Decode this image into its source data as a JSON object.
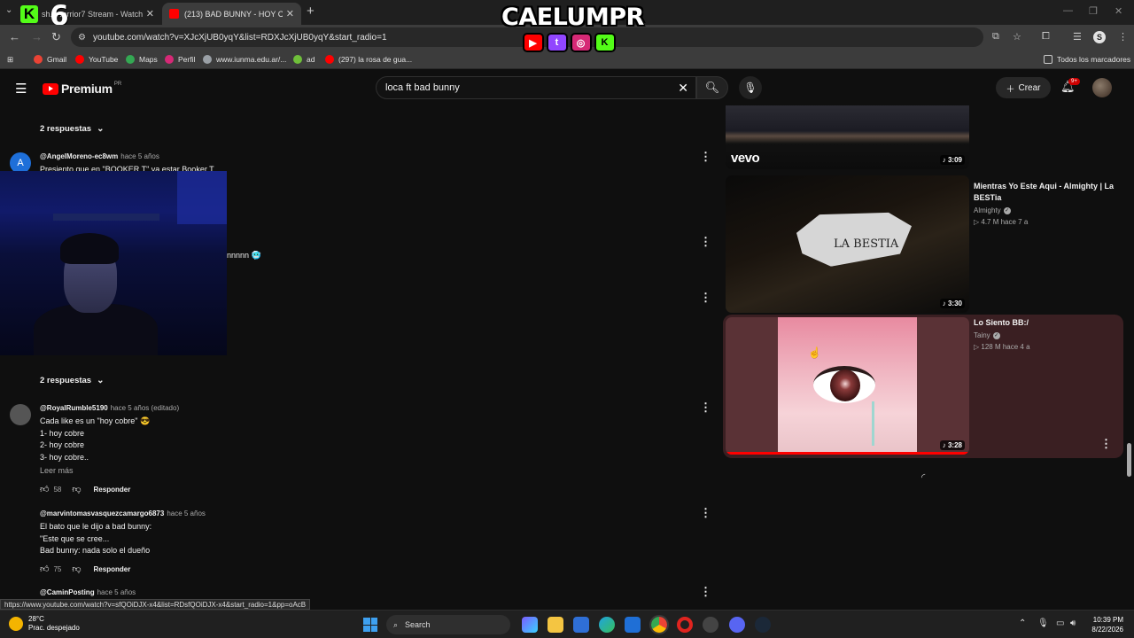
{
  "browser": {
    "tabs": [
      {
        "label": "sh...warrior7 Stream - Watch",
        "fav_color": "#53fc18"
      },
      {
        "label": "(213) BAD BUNNY - HOY COBRE",
        "fav_color": "#ff0000"
      }
    ],
    "url": "youtube.com/watch?v=XJcXjUB0yqY&list=RDXJcXjUB0yqY&start_radio=1",
    "bookmarks": [
      "Gmail",
      "YouTube",
      "Maps",
      "Perfil",
      "www.iunma.edu.ar/...",
      "ad",
      "(297) la rosa de gua..."
    ],
    "all_bookmarks": "Todos los marcadores",
    "status_url": "https://www.youtube.com/watch?v=sfQOiDJX-x4&list=RDsfQOiDJX-x4&start_radio=1&pp=oAcB"
  },
  "overlay": {
    "brand": "CAELUMPR",
    "number": "6",
    "k": "K",
    "socials": [
      {
        "icon": "youtube-icon",
        "glyph": "▶",
        "color": "#ff0000"
      },
      {
        "icon": "twitch-icon",
        "glyph": "t",
        "color": "#9146ff"
      },
      {
        "icon": "instagram-icon",
        "glyph": "◎",
        "color": "#d62976"
      },
      {
        "icon": "kick-icon",
        "glyph": "K",
        "color": "#53fc18"
      }
    ]
  },
  "youtube": {
    "logo_word": "Premium",
    "region": "PR",
    "search_value": "loca ft bad bunny",
    "create_label": "Crear",
    "notif_badge": "9+"
  },
  "comments": {
    "replies_label": "2 respuestas",
    "items": [
      {
        "author": "@AngelMoreno-ec8wm",
        "time": "hace 5 años",
        "text": "Presiento que en \"BOOKER T\" va estar Booker T",
        "avatar_letter": "A",
        "avatar_color": "#1e6fd9"
      },
      {
        "text_fragment": "nnnnn 🥶"
      },
      {
        "author": "@RoyalRumble5190",
        "time": "hace 5 años (editado)",
        "text": "Cada like es un \"hoy cobre\" 😎\n1- hoy cobre\n2- hoy cobre\n3- hoy cobre..",
        "more": "Leer más",
        "likes": "58",
        "reply": "Responder"
      },
      {
        "author": "@marvintomasvasquezcamargo6873",
        "time": "hace 5 años",
        "text": "El bato que le dijo a bad bunny:\n\"Este que se cree...\nBad bunny: nada solo el dueño",
        "likes": "75",
        "reply": "Responder"
      },
      {
        "author": "@CaminPosting",
        "time": "hace 5 años"
      }
    ]
  },
  "sidebar": {
    "videos": [
      {
        "duration": "3:09",
        "label": "vevo"
      },
      {
        "title": "Mientras Yo Este Aqui - Almighty | La BESTia",
        "channel": "Almighty",
        "meta": "4.7 M  hace 7 a",
        "duration": "3:30"
      },
      {
        "title": "Lo Siento BB:/",
        "channel": "Tainy",
        "meta": "128 M  hace 4 a",
        "duration": "3:28",
        "watched_fraction": 1.0
      }
    ]
  },
  "taskbar": {
    "temp": "28°C",
    "weather": "Prac. despejado",
    "search": "Search",
    "time": "10:39 PM",
    "date": "8/22/2026"
  }
}
